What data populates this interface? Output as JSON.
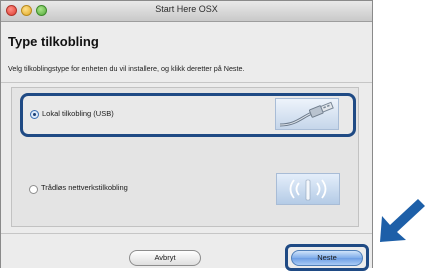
{
  "window": {
    "title": "Start Here OSX"
  },
  "page": {
    "heading": "Type tilkobling",
    "instruction": "Velg tilkoblingstype for enheten du vil installere, og klikk deretter på Neste."
  },
  "options": [
    {
      "label": "Lokal tilkobling (USB)",
      "selected": true,
      "highlighted": true,
      "icon": "usb-cable-icon"
    },
    {
      "label": "Trådløs nettverkstilkobling",
      "selected": false,
      "highlighted": false,
      "icon": "wireless-signal-icon"
    }
  ],
  "buttons": {
    "cancel": "Avbryt",
    "next": "Neste"
  },
  "colors": {
    "highlight": "#1f4a84",
    "arrow": "#1d5fa8",
    "window_bg": "#ececec"
  }
}
